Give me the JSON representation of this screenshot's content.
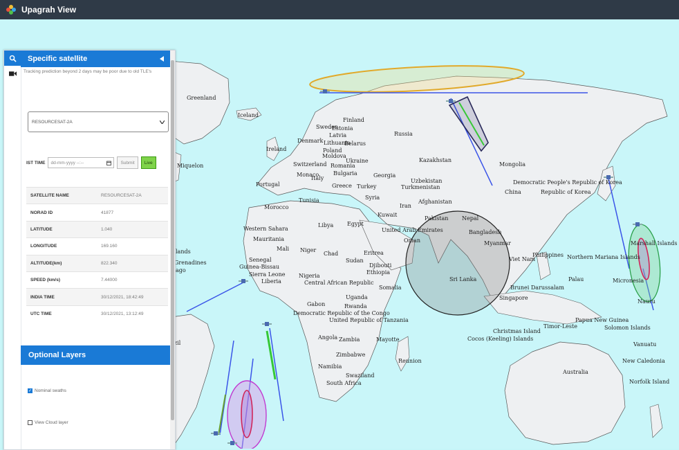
{
  "app": {
    "title": "Upagrah View"
  },
  "panel": {
    "title": "Specific satellite",
    "collapse_icon": "caret-left-icon",
    "note": "Tracking prediction beyond 2 days may be poor due to old TLE's",
    "satellite_select": {
      "value": "RESOURCESAT-2A"
    },
    "ist_time": {
      "label": "IST TIME",
      "placeholder": "dd-mm-yyyy --:--",
      "submit_label": "Submit",
      "live_label": "Live"
    },
    "info_rows": [
      {
        "key": "SATELLITE NAME",
        "value": "RESOURCESAT-2A"
      },
      {
        "key": "NORAD ID",
        "value": "41877"
      },
      {
        "key": "LATITUDE",
        "value": "1.040"
      },
      {
        "key": "LONGITUDE",
        "value": "169.160"
      },
      {
        "key": "ALTITUDE(km)",
        "value": "822.340"
      },
      {
        "key": "SPEED (km/s)",
        "value": "7.44000"
      },
      {
        "key": "INDIA TIME",
        "value": "30/12/2021, 18:42:49"
      },
      {
        "key": "UTC TIME",
        "value": "30/12/2021, 13:12:49"
      }
    ],
    "optional_layers": {
      "title": "Optional Layers",
      "nominal_swaths": {
        "label": "Nominal swaths",
        "checked": true
      },
      "cloud_layer": {
        "label": "View Cloud layer",
        "checked": false
      }
    }
  },
  "map": {
    "labels": {
      "greenland": "Greenland",
      "iceland": "Iceland",
      "ireland": "Ireland",
      "denmark": "Denmark",
      "sweden": "Sweden",
      "finland": "Finland",
      "estonia": "Estonia",
      "latvia": "Latvia",
      "lithuania": "Lithuania",
      "belarus": "Belarus",
      "poland": "Poland",
      "ukraine": "Ukraine",
      "romania": "Romania",
      "switzerland": "Switzerland",
      "monaco": "Monaco",
      "moldova": "Moldova",
      "bulgaria": "Bulgaria",
      "georgia": "Georgia",
      "portugal": "Portugal",
      "italy": "Italy",
      "greece": "Greece",
      "turkey": "Turkey",
      "russia": "Russia",
      "kazakhstan": "Kazakhstan",
      "uzbekistan": "Uzbekistan",
      "turkmenistan": "Turkmenistan",
      "mongolia": "Mongolia",
      "north_korea": "Democratic People's Republic of Korea",
      "south_korea": "Republic of Korea",
      "china": "China",
      "morocco": "Morocco",
      "tunisia": "Tunisia",
      "syria": "Syria",
      "iran": "Iran",
      "afghanistan": "Afghanistan",
      "pakistan": "Pakistan",
      "nepal": "Nepal",
      "bangladesh": "Bangladesh",
      "myanmar": "Myanmar",
      "viet_nam": "Viet Nam",
      "philippines": "Philippines",
      "n_mariana": "Northern Mariana Islands",
      "palau": "Palau",
      "micronesia": "Micronesia",
      "marshall": "Marshall Islands",
      "brunei": "Brunei Darussalam",
      "singapore": "Singapore",
      "sri_lanka": "Sri Lanka",
      "libya": "Libya",
      "egypt": "Egypt",
      "kuwait": "Kuwait",
      "uae": "United Arab Emirates",
      "oman": "Oman",
      "western_sahara": "Western Sahara",
      "mauritania": "Mauritania",
      "mali": "Mali",
      "niger": "Niger",
      "chad": "Chad",
      "sudan": "Sudan",
      "eritrea": "Eritrea",
      "djibouti": "Djibouti",
      "ethiopia": "Ethiopia",
      "somalia": "Somalia",
      "senegal": "Senegal",
      "guinea_bissau": "Guinea-Bissau",
      "sierra_leone": "Sierra Leone",
      "liberia": "Liberia",
      "nigeria": "Nigeria",
      "car": "Central African Republic",
      "gabon": "Gabon",
      "drc": "Democratic Republic of the Congo",
      "uganda": "Uganda",
      "rwanda": "Rwanda",
      "tanzania": "United Republic of Tanzania",
      "angola": "Angola",
      "zambia": "Zambia",
      "mayotte": "Mayotte",
      "zimbabwe": "Zimbabwe",
      "namibia": "Namibia",
      "swaziland": "Swaziland",
      "south_africa": "South Africa",
      "reunion": "Reunion",
      "christmas": "Christmas Island",
      "cocos": "Cocos (Keeling) Islands",
      "timor": "Timor-Leste",
      "papua": "Papua New Guinea",
      "solomon": "Solomon Islands",
      "vanuatu": "Vanuatu",
      "new_caledonia": "New Caledonia",
      "norfolk": "Norfolk Island",
      "australia": "Australia",
      "nauru": "Nauru",
      "miquelon": "Miquelon",
      "grenadines": "Grenadines",
      "lands": "lands",
      "ago": "ago",
      "zil": "zil"
    }
  },
  "colors": {
    "accent": "#1a7ad6",
    "header": "#2f3a47",
    "ocean": "#c9f6f9",
    "land": "#eef0f2",
    "border": "#555555",
    "live": "#7fd34a"
  }
}
